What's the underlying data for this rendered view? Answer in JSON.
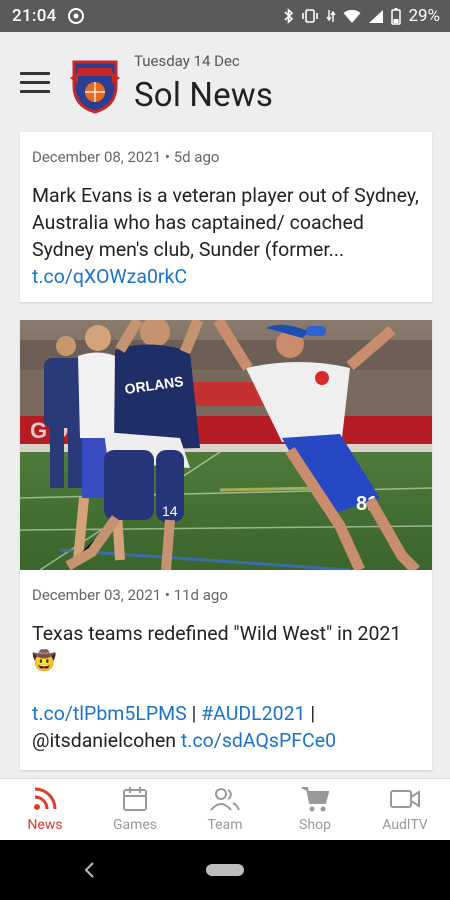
{
  "status": {
    "time": "21:04",
    "battery": "29%"
  },
  "header": {
    "date": "Tuesday 14 Dec",
    "title": "Sol News"
  },
  "posts": [
    {
      "meta": "December 08, 2021 • 5d ago",
      "text": "Mark Evans is a veteran player out of Sydney, Australia who has captained/ coached Sydney men's club, Sunder (former...",
      "link": "t.co/qXOWza0rkC"
    },
    {
      "meta": "December 03, 2021 • 11d ago",
      "line1": "Texas teams redefined \"Wild West\" in 2021 🤠",
      "link1": "t.co/tlPbm5LPMS",
      "sep1": " | ",
      "hashtag": "#AUDL2021",
      "sep2": " |",
      "handle": "@itsdanielcohen ",
      "link2": "t.co/sdAQsPFCe0"
    }
  ],
  "nav": [
    {
      "label": "News",
      "icon": "rss-icon",
      "active": true
    },
    {
      "label": "Games",
      "icon": "calendar-icon",
      "active": false
    },
    {
      "label": "Team",
      "icon": "team-icon",
      "active": false
    },
    {
      "label": "Shop",
      "icon": "cart-icon",
      "active": false
    },
    {
      "label": "AudlTV",
      "icon": "video-icon",
      "active": false
    }
  ],
  "colors": {
    "accent": "#e0392b",
    "link": "#1a73c9",
    "statusbar": "#5a5a5a"
  }
}
